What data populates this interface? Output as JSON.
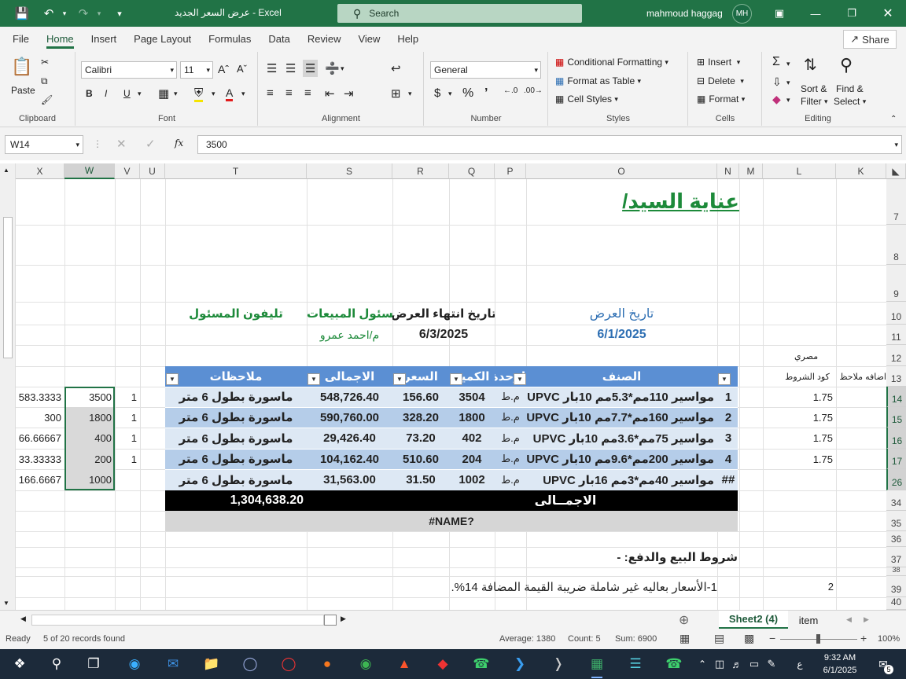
{
  "window": {
    "title": "عرض السعر الجديد  -  Excel",
    "search_placeholder": "Search",
    "user": "mahmoud haggag",
    "user_initials": "MH"
  },
  "menu": [
    "File",
    "Home",
    "Insert",
    "Page Layout",
    "Formulas",
    "Data",
    "Review",
    "View",
    "Help"
  ],
  "share": "Share",
  "ribbon": {
    "paste": "Paste",
    "clipboard": "Clipboard",
    "font_name": "Calibri",
    "font_size": "11",
    "font": "Font",
    "alignment": "Alignment",
    "number_format": "General",
    "number": "Number",
    "conditional_formatting": "Conditional Formatting",
    "format_as_table": "Format as Table",
    "cell_styles": "Cell Styles",
    "styles": "Styles",
    "insert": "Insert",
    "delete": "Delete",
    "format": "Format",
    "cells": "Cells",
    "sort_filter_1": "Sort &",
    "sort_filter_2": "Filter",
    "find_select_1": "Find &",
    "find_select_2": "Select",
    "editing": "Editing"
  },
  "formula_bar": {
    "name_box": "W14",
    "fx": "fx",
    "value": "3500"
  },
  "columns": [
    "X",
    "W",
    "V",
    "U",
    "T",
    "S",
    "R",
    "Q",
    "P",
    "O",
    "N",
    "M",
    "L",
    "K"
  ],
  "rows": [
    "7",
    "8",
    "9",
    "10",
    "11",
    "12",
    "13",
    "14",
    "15",
    "16",
    "17",
    "26",
    "34",
    "35",
    "36",
    "37",
    "38",
    "39",
    "40"
  ],
  "sheet": {
    "title": "عناية السيد/",
    "offer_date_label": "تاريخ العرض",
    "offer_date": "6/1/2025",
    "offer_end_label": "تاريخ انتهاء العرض",
    "offer_end": "6/3/2025",
    "sales_label": "مسئول المبيعات",
    "sales_name": "م/احمد عمرو",
    "phone_label": "تليفون المسئول",
    "k12": "مصري",
    "k13": "اضافه ملاحظ",
    "l13": "كود الشروط",
    "headers": {
      "item": "الصنف",
      "unit": "الوحدة",
      "qty": "الكمية",
      "price": "السعر",
      "total": "الاجمالى",
      "notes": "ملاحظات"
    },
    "table_rows": [
      {
        "n": "1",
        "item": "مواسير 110مم*5.3مم 10بار UPVC",
        "unit": "م.ط",
        "qty": "3504",
        "price": "156.60",
        "total": "548,726.40",
        "notes": "ماسورة بطول 6 متر",
        "l": "1.75",
        "v": "1",
        "w": "3500",
        "x": "583.3333"
      },
      {
        "n": "2",
        "item": "مواسير 160مم*7.7مم 10بار UPVC",
        "unit": "م.ط",
        "qty": "1800",
        "price": "328.20",
        "total": "590,760.00",
        "notes": "ماسورة بطول 6 متر",
        "l": "1.75",
        "v": "1",
        "w": "1800",
        "x": "300"
      },
      {
        "n": "3",
        "item": "مواسير 75مم*3.6مم 10بار UPVC",
        "unit": "م.ط",
        "qty": "402",
        "price": "73.20",
        "total": "29,426.40",
        "notes": "ماسورة بطول 6 متر",
        "l": "1.75",
        "v": "1",
        "w": "400",
        "x": "66.66667"
      },
      {
        "n": "4",
        "item": "مواسير 200مم*9.6مم 10بار UPVC",
        "unit": "م.ط",
        "qty": "204",
        "price": "510.60",
        "total": "104,162.40",
        "notes": "ماسورة بطول 6 متر",
        "l": "1.75",
        "v": "1",
        "w": "200",
        "x": "33.33333"
      },
      {
        "n": "##",
        "item": "مواسير 40مم*3مم 16بار UPVC",
        "unit": "م.ط",
        "qty": "1002",
        "price": "31.50",
        "total": "31,563.00",
        "notes": "ماسورة بطول 6 متر",
        "l": "",
        "v": "",
        "w": "1000",
        "x": "166.6667"
      }
    ],
    "total_label": "الاجمــالى",
    "grand_total": "1,304,638.20",
    "name_error": "#NAME?",
    "terms_title": "شروط البيع والدفع: -",
    "term1": "1-الأسعار بعاليه غير شاملة ضريبة القيمة المضافة 14%.",
    "l39": "2"
  },
  "tabs": {
    "active": "Sheet2 (4)",
    "other": "item"
  },
  "status": {
    "ready": "Ready",
    "records": "5 of 20 records found",
    "average": "Average: 1380",
    "count": "Count: 5",
    "sum": "Sum: 6900",
    "zoom": "100%"
  },
  "clock": {
    "time": "9:32 AM",
    "date": "6/1/2025",
    "lang": "ع",
    "notif": "5"
  }
}
